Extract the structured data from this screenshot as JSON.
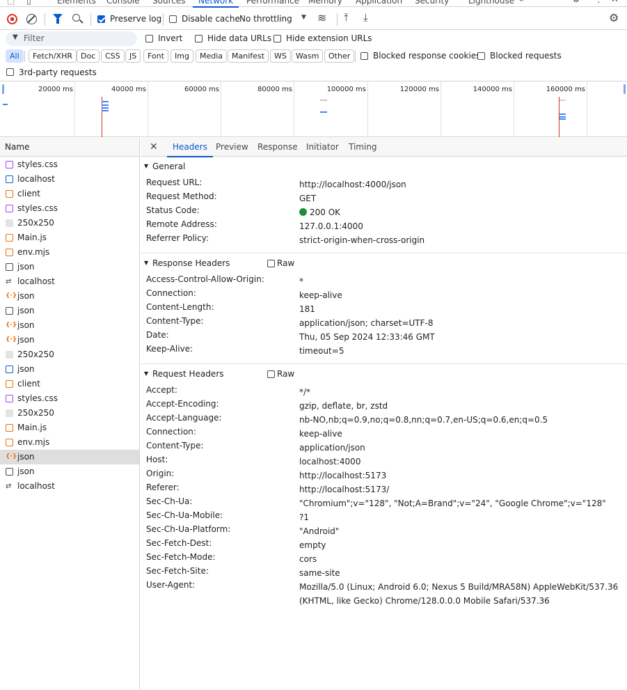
{
  "devtools_tabs": [
    "Elements",
    "Console",
    "Sources",
    "Network",
    "Performance",
    "Memory",
    "Application",
    "Security",
    "Lighthouse"
  ],
  "active_devtools_tab": "Network",
  "toolbar": {
    "preserve_log": "Preserve log",
    "disable_cache": "Disable cache",
    "throttling": "No throttling"
  },
  "filterbar": {
    "filter_placeholder": "Filter",
    "invert": "Invert",
    "hide_data_urls": "Hide data URLs",
    "hide_extension_urls": "Hide extension URLs"
  },
  "type_filters": [
    "All",
    "Fetch/XHR",
    "Doc",
    "CSS",
    "JS",
    "Font",
    "Img",
    "Media",
    "Manifest",
    "WS",
    "Wasm",
    "Other"
  ],
  "blocked_response_cookies": "Blocked response cookies",
  "blocked_requests": "Blocked requests",
  "third_party": "3rd-party requests",
  "overview_ticks": [
    "20000 ms",
    "40000 ms",
    "60000 ms",
    "80000 ms",
    "100000 ms",
    "120000 ms",
    "140000 ms",
    "160000 ms"
  ],
  "list_header": "Name",
  "requests": [
    {
      "name": "styles.css",
      "type": "css"
    },
    {
      "name": "localhost",
      "type": "doc"
    },
    {
      "name": "client",
      "type": "js"
    },
    {
      "name": "styles.css",
      "type": "css"
    },
    {
      "name": "250x250",
      "type": "img"
    },
    {
      "name": "Main.js",
      "type": "js"
    },
    {
      "name": "env.mjs",
      "type": "js"
    },
    {
      "name": "json",
      "type": "other"
    },
    {
      "name": "localhost",
      "type": "ws"
    },
    {
      "name": "json",
      "type": "fetch"
    },
    {
      "name": "json",
      "type": "other"
    },
    {
      "name": "json",
      "type": "fetch"
    },
    {
      "name": "json",
      "type": "fetch"
    },
    {
      "name": "250x250",
      "type": "img"
    },
    {
      "name": "json",
      "type": "doc"
    },
    {
      "name": "client",
      "type": "js"
    },
    {
      "name": "styles.css",
      "type": "css"
    },
    {
      "name": "250x250",
      "type": "img"
    },
    {
      "name": "Main.js",
      "type": "js"
    },
    {
      "name": "env.mjs",
      "type": "js"
    },
    {
      "name": "json",
      "type": "fetch"
    },
    {
      "name": "json",
      "type": "other"
    },
    {
      "name": "localhost",
      "type": "ws"
    }
  ],
  "detail_tabs": [
    "Headers",
    "Preview",
    "Response",
    "Initiator",
    "Timing"
  ],
  "active_detail_tab": "Headers",
  "general": {
    "title": "General",
    "rows": [
      {
        "k": "Request URL:",
        "v": "http://localhost:4000/json"
      },
      {
        "k": "Request Method:",
        "v": "GET"
      },
      {
        "k": "Status Code:",
        "v": "200 OK"
      },
      {
        "k": "Remote Address:",
        "v": "127.0.0.1:4000"
      },
      {
        "k": "Referrer Policy:",
        "v": "strict-origin-when-cross-origin"
      }
    ]
  },
  "response_headers": {
    "title": "Response Headers",
    "raw": "Raw",
    "rows": [
      {
        "k": "Access-Control-Allow-Origin:",
        "v": "*"
      },
      {
        "k": "Connection:",
        "v": "keep-alive"
      },
      {
        "k": "Content-Length:",
        "v": "181"
      },
      {
        "k": "Content-Type:",
        "v": "application/json; charset=UTF-8"
      },
      {
        "k": "Date:",
        "v": "Thu, 05 Sep 2024 12:33:46 GMT"
      },
      {
        "k": "Keep-Alive:",
        "v": "timeout=5"
      }
    ]
  },
  "request_headers": {
    "title": "Request Headers",
    "raw": "Raw",
    "rows": [
      {
        "k": "Accept:",
        "v": "*/*"
      },
      {
        "k": "Accept-Encoding:",
        "v": "gzip, deflate, br, zstd"
      },
      {
        "k": "Accept-Language:",
        "v": "nb-NO,nb;q=0.9,no;q=0.8,nn;q=0.7,en-US;q=0.6,en;q=0.5"
      },
      {
        "k": "Connection:",
        "v": "keep-alive"
      },
      {
        "k": "Content-Type:",
        "v": "application/json"
      },
      {
        "k": "Host:",
        "v": "localhost:4000"
      },
      {
        "k": "Origin:",
        "v": "http://localhost:5173"
      },
      {
        "k": "Referer:",
        "v": "http://localhost:5173/"
      },
      {
        "k": "Sec-Ch-Ua:",
        "v": "\"Chromium\";v=\"128\", \"Not;A=Brand\";v=\"24\", \"Google Chrome\";v=\"128\""
      },
      {
        "k": "Sec-Ch-Ua-Mobile:",
        "v": "?1"
      },
      {
        "k": "Sec-Ch-Ua-Platform:",
        "v": "\"Android\""
      },
      {
        "k": "Sec-Fetch-Dest:",
        "v": "empty"
      },
      {
        "k": "Sec-Fetch-Mode:",
        "v": "cors"
      },
      {
        "k": "Sec-Fetch-Site:",
        "v": "same-site"
      },
      {
        "k": "User-Agent:",
        "v": "Mozilla/5.0 (Linux; Android 6.0; Nexus 5 Build/MRA58N) AppleWebKit/537.36 (KHTML, like Gecko) Chrome/128.0.0.0 Mobile Safari/537.36"
      }
    ]
  }
}
